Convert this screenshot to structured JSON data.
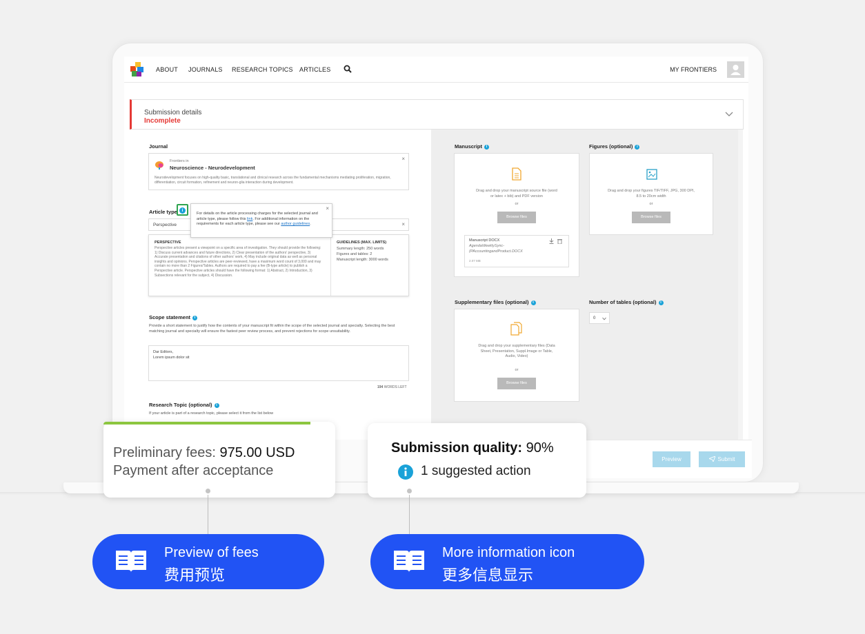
{
  "nav": {
    "links": [
      "ABOUT",
      "JOURNALS",
      "RESEARCH TOPICS",
      "ARTICLES"
    ],
    "my_frontiers": "MY FRONTIERS"
  },
  "submission": {
    "title": "Submission details",
    "status": "Incomplete",
    "status_color": "#e53935"
  },
  "journal": {
    "label": "Journal",
    "prefix": "Frontiers in",
    "name": "Neuroscience - Neurodevelopment",
    "description": "Neurodevelopment focuses on high-quality basic, translational and clinical research across the fundamental mechanisms mediating proliferation, migration, differentiation, circuit formation, refinement and neuron-glia interaction during development."
  },
  "article_type": {
    "label": "Article type",
    "value": "Perspective",
    "tooltip_pre": "For details on the article processing charges for the selected journal and article type, please follow this",
    "tooltip_link1": "link",
    "tooltip_mid": ". For additional information on the requirements for each article type, please see our",
    "tooltip_link2": "author guidelines",
    "tooltip_end": ".",
    "desc_title": "PERSPECTIVE",
    "desc_text": "Perspective articles present a viewpoint on a specific area of investigation. They should provide the following: 1) Discuss current advances and future directions, 2) Clear presentation of the authors' perspective, 3) Accurate presentation and citations of other authors' work, 4) May include original data as well as personal insights and opinions. Perspective articles are peer-reviewed, have a maximum word count of 3,000 and may contain no more than 2 Figures/Tables. Authors are required to pay a fee (B-type article) to publish a Perspective article. Perspective articles should have the following format: 1) Abstract, 2) Introduction, 3) Subsections relevant for the subject, 4) Discussion.",
    "guidelines_title": "GUIDELINES (MAX. LIMITS)",
    "guidelines": [
      "Summary length: 250 words",
      "Figures and tables: 2",
      "Manuscript length: 3000 words"
    ]
  },
  "scope": {
    "label": "Scope statement",
    "help": "Provide a short statement to justify how the contents of your manuscript fit within the scope of the selected journal and specialty. Selecting the best matching journal and specialty will ensure the fastest peer review process, and prevent rejections for scope unsuitability.",
    "line1": "Dar Editors,",
    "line2": "Lorem ipsum dolor sit",
    "words_left": "194",
    "words_left_label": "WORDS LEFT"
  },
  "research_topic": {
    "label": "Research Topic (optional)",
    "help": "If your article is part of a research topic, please select it from the list below"
  },
  "manuscript": {
    "label": "Manuscript",
    "drop_text": "Drag and drop your manuscript source file (word or latex + bib) and PDF version",
    "or": "or",
    "browse": "Browse files",
    "file_title": "Manuscript DOCX",
    "file_name": "AgendaWeeklySync-(PAccountingandProduct.DOCX",
    "file_size": "2.07 MB"
  },
  "figures": {
    "label": "Figures (optional)",
    "drop_text": "Drag and drop your figures TIF/TIFF, JPG, 300 DPI, 8.5 to 20cm width",
    "or": "or",
    "browse": "Browse files"
  },
  "supplementary": {
    "label": "Supplementary files (optional)",
    "drop_text": "Drag and drop your supplementary files (Data Sheet, Presentation, Suppl.Image or Table, Audio, Video)",
    "or": "or",
    "browse": "Browse files"
  },
  "tables": {
    "label": "Number of tables (optional)",
    "value": "0"
  },
  "actions": {
    "preview": "Preview",
    "submit": "Submit"
  },
  "fees_callout": {
    "label": "Preliminary fees:",
    "amount": "975.00 USD",
    "note": "Payment after acceptance"
  },
  "quality_callout": {
    "label": "Submission quality:",
    "value": "90%",
    "action": "1 suggested action"
  },
  "pills": [
    {
      "line1": "Preview of fees",
      "line2": "费用预览"
    },
    {
      "line1": "More information icon",
      "line2": "更多信息显示"
    }
  ],
  "colors": {
    "accent_blue": "#2153f4",
    "info": "#1aa2d8",
    "highlight_green": "#2ea44f",
    "progress_green": "#8cc63f",
    "button_light_blue": "#a8d8ec"
  },
  "icons": [
    "frontiers-logo",
    "search-icon",
    "avatar-icon",
    "chevron-down-icon",
    "info-icon",
    "close-icon",
    "document-icon",
    "image-icon",
    "files-icon",
    "download-icon",
    "trash-icon",
    "send-icon",
    "book-icon"
  ]
}
